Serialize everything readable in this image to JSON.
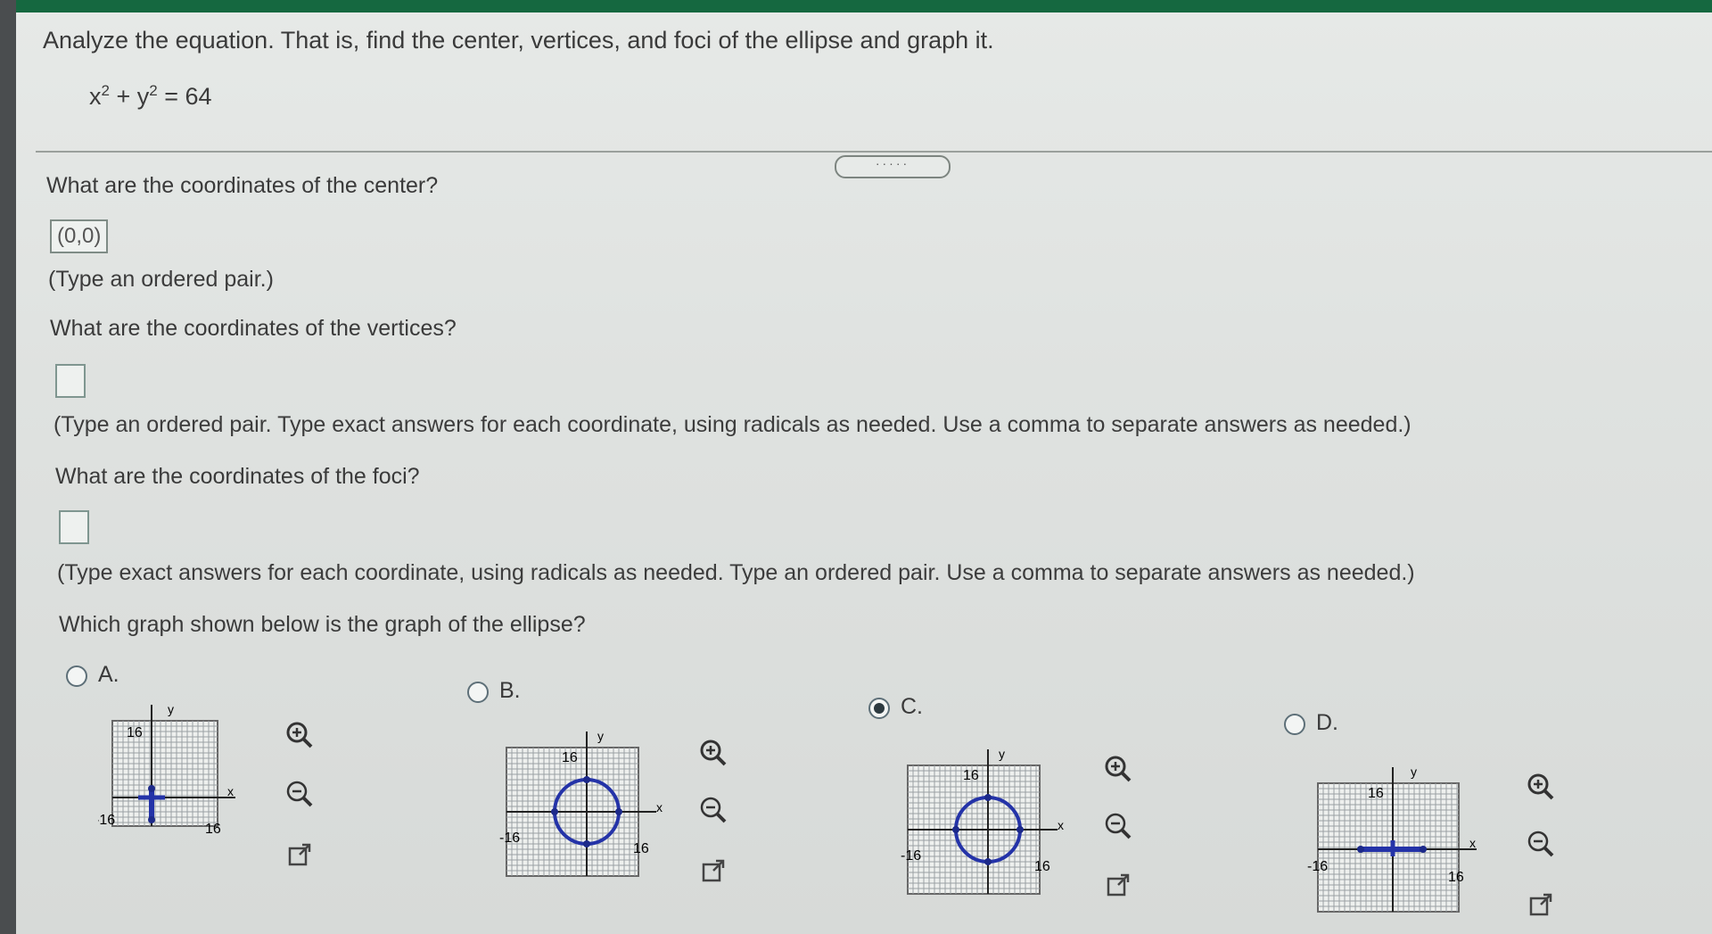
{
  "question": {
    "prompt": "Analyze the equation. That is, find the center, vertices, and foci of the ellipse and graph it.",
    "equation": {
      "x_term": "x",
      "x_exp": "2",
      "plus": "+",
      "y_term": "y",
      "y_exp": "2",
      "rhs": "= 64"
    }
  },
  "more_button": "·····",
  "center": {
    "question": "What are the coordinates of the center?",
    "answer": "(0,0)",
    "hint": "(Type an ordered pair.)"
  },
  "vertices": {
    "question": "What are the coordinates of the vertices?",
    "answer": "",
    "hint": "(Type an ordered pair.  Type exact answers for each coordinate, using radicals as needed. Use a comma to separate answers as needed.)"
  },
  "foci": {
    "question": "What are the coordinates of the foci?",
    "answer": "",
    "hint": "(Type exact answers for each coordinate, using radicals as needed. Type an ordered pair. Use a comma to separate answers as needed.)"
  },
  "graph_question": "Which graph shown below is the graph of the ellipse?",
  "options": [
    {
      "letter": "A.",
      "selected": false,
      "graph": "vertical-segment"
    },
    {
      "letter": "B.",
      "selected": false,
      "graph": "circle"
    },
    {
      "letter": "C.",
      "selected": true,
      "graph": "circle"
    },
    {
      "letter": "D.",
      "selected": false,
      "graph": "horizontal-segment"
    }
  ],
  "axis_labels": {
    "x": "x",
    "y": "y",
    "pos": "16",
    "neg": "-16"
  },
  "icons": {
    "zoom_in": "zoom-in-icon",
    "zoom_out": "zoom-out-icon",
    "popout": "external-link-icon"
  },
  "colors": {
    "topbar": "#156840",
    "graph_stroke": "#2433a8",
    "point": "#1d2a8a"
  }
}
